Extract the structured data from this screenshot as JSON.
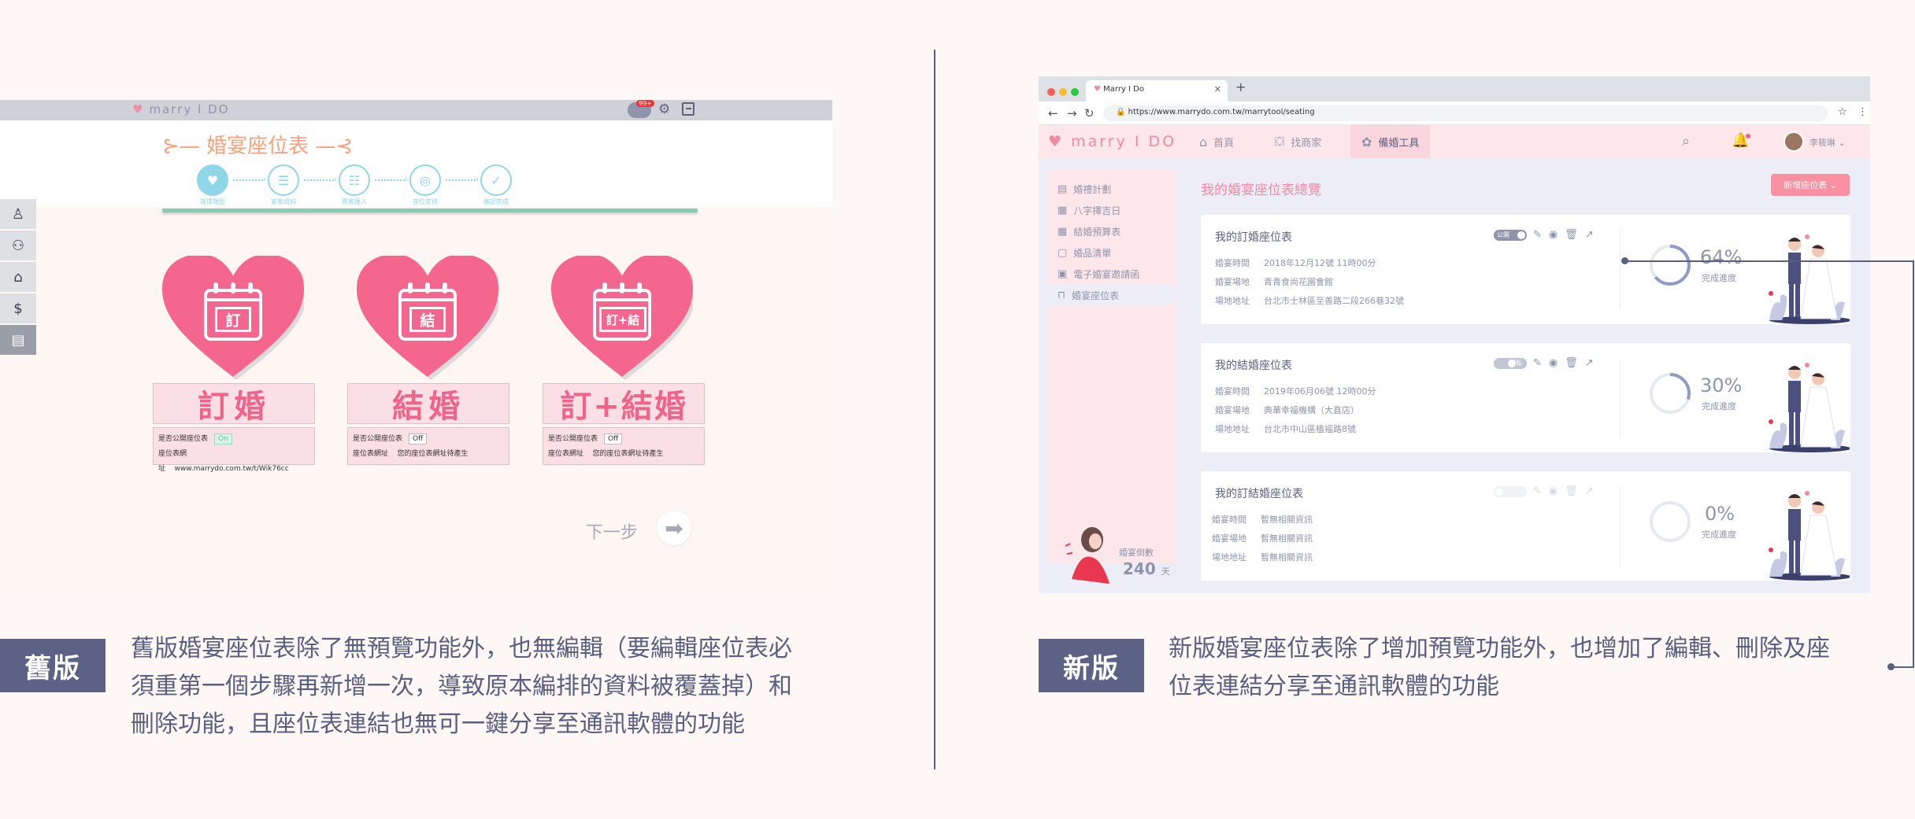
{
  "colors": {
    "accent": "#5c6285",
    "pink": "#f0638a",
    "heart": "#f5668e",
    "teal": "#8fd6e8"
  },
  "old": {
    "logo": "marry I DO",
    "chat_badge": "99+",
    "title": "婚宴座位表",
    "steps": [
      {
        "label": "選擇類型",
        "icon": "heart-icon"
      },
      {
        "label": "宴客資料",
        "icon": "list-icon"
      },
      {
        "label": "賓客匯入",
        "icon": "people-icon"
      },
      {
        "label": "座位安排",
        "icon": "table-icon"
      },
      {
        "label": "確認完成",
        "icon": "check-icon"
      }
    ],
    "side_icons": [
      "person-icon",
      "people-icon",
      "shop-icon",
      "money-bag-icon",
      "clipboard-icon"
    ],
    "types": [
      {
        "cal": "訂",
        "title": "訂婚",
        "public_label": "是否公開座位表",
        "public_value": "On",
        "url_label": "座位表網址",
        "url_value": "www.marrydo.com.tw/t/Wik76cc"
      },
      {
        "cal": "結",
        "title": "結婚",
        "public_label": "是否公開座位表",
        "public_value": "Off",
        "url_label": "座位表網址",
        "url_value": "您的座位表網址待產生"
      },
      {
        "cal": "訂+結",
        "title": "訂+結婚",
        "public_label": "是否公開座位表",
        "public_value": "Off",
        "url_label": "座位表網址",
        "url_value": "您的座位表網址待產生"
      }
    ],
    "next": "下一步"
  },
  "new": {
    "tab_title": "Marry I Do",
    "url": "https://www.marrydo.com.tw/marrytool/seating",
    "logo": "marry I DO",
    "menu": [
      {
        "label": "首頁",
        "icon": "home-icon"
      },
      {
        "label": "找商家",
        "icon": "shop-icon"
      },
      {
        "label": "備婚工具",
        "icon": "tools-icon"
      }
    ],
    "user": "李筱琳",
    "side": [
      {
        "label": "婚禮計劃",
        "icon": "plan-icon"
      },
      {
        "label": "八字擇吉日",
        "icon": "calendar-icon"
      },
      {
        "label": "結婚預算表",
        "icon": "budget-icon"
      },
      {
        "label": "婚品清單",
        "icon": "checklist-icon"
      },
      {
        "label": "電子婚宴邀請函",
        "icon": "invite-icon"
      },
      {
        "label": "婚宴座位表",
        "icon": "seat-icon"
      }
    ],
    "countdown_label": "婚宴倒數",
    "countdown_value": "240",
    "countdown_unit": "天",
    "page_title": "我的婚宴座位表總覽",
    "new_button": "新增座位表",
    "cards": [
      {
        "title": "我的訂婚座位表",
        "toggle": "公開",
        "rows": [
          [
            "婚宴時間",
            "2018年12月12號 11時00分"
          ],
          [
            "婚宴場地",
            "青青食尚花園會館"
          ],
          [
            "場地地址",
            "台北市士林區至善路二段266巷32號"
          ]
        ],
        "percent": "64%",
        "progress": 0.64,
        "progress_label": "完成進度"
      },
      {
        "title": "我的結婚座位表",
        "toggle": "隱私",
        "rows": [
          [
            "婚宴時間",
            "2019年06月06號 12時00分"
          ],
          [
            "婚宴場地",
            "典華幸福機構（大直店）"
          ],
          [
            "場地地址",
            "台北市中山區植福路8號"
          ]
        ],
        "percent": "30%",
        "progress": 0.3,
        "progress_label": "完成進度"
      },
      {
        "title": "我的訂結婚座位表",
        "toggle": "",
        "rows": [
          [
            "婚宴時間",
            "暫無相關資訊"
          ],
          [
            "婚宴場地",
            "暫無相關資訊"
          ],
          [
            "場地地址",
            "暫無相關資訊"
          ]
        ],
        "percent": "0%",
        "progress": 0,
        "progress_label": "完成進度"
      }
    ]
  },
  "captions": {
    "old_badge": "舊版",
    "old_lines": [
      "舊版婚宴座位表除了無預覽功能外，也無編輯（要編輯座位表必",
      "須重第一個步驟再新增一次，導致原本編排的資料被覆蓋掉）和",
      "刪除功能，且座位表連結也無可一鍵分享至通訊軟體的功能"
    ],
    "new_badge": "新版",
    "new_lines": [
      "新版婚宴座位表除了增加預覽功能外，也增加了編輯、刪除及座",
      "位表連結分享至通訊軟體的功能"
    ]
  }
}
